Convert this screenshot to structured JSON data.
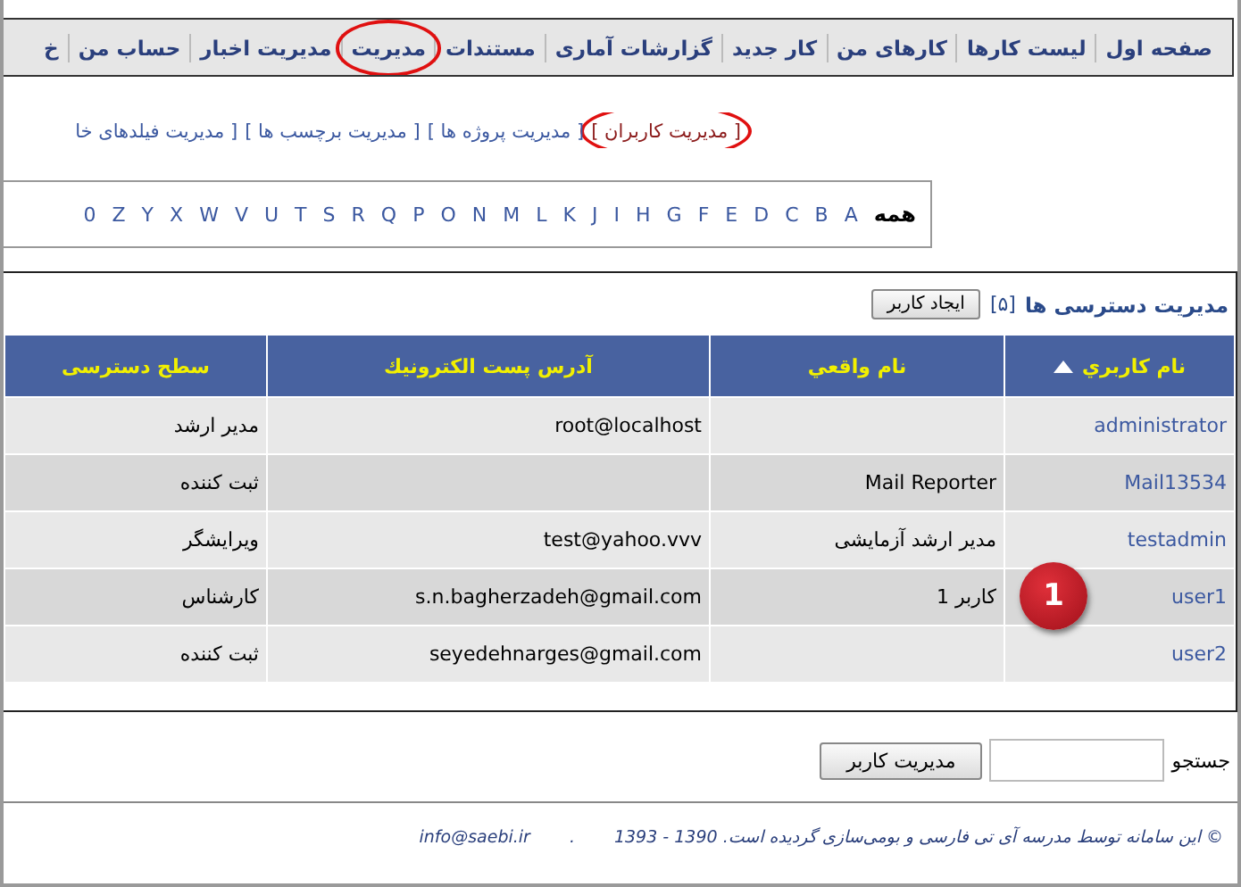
{
  "nav": [
    {
      "label": "صفحه اول",
      "circled": false
    },
    {
      "label": "لیست کارها",
      "circled": false
    },
    {
      "label": "کارهای من",
      "circled": false
    },
    {
      "label": "کار جدید",
      "circled": false
    },
    {
      "label": "گزارشات آماری",
      "circled": false
    },
    {
      "label": "مستندات",
      "circled": false
    },
    {
      "label": "مدیریت",
      "circled": true
    },
    {
      "label": "مدیریت اخبار",
      "circled": false
    },
    {
      "label": "حساب من",
      "circled": false
    },
    {
      "label": "خ",
      "circled": false
    }
  ],
  "sublinks": [
    {
      "label": "[ مدیریت کاربران ]",
      "selected": true,
      "circled": true
    },
    {
      "label": "[ مدیریت پروژه ها ]",
      "selected": false,
      "circled": false
    },
    {
      "label": "[ مدیریت برچسب ها ]",
      "selected": false,
      "circled": false
    },
    {
      "label": "[ مدیریت فیلدهای خا",
      "selected": false,
      "circled": false
    }
  ],
  "letters": [
    {
      "label": "همه",
      "selected": true
    },
    {
      "label": "A",
      "selected": false
    },
    {
      "label": "B",
      "selected": false
    },
    {
      "label": "C",
      "selected": false
    },
    {
      "label": "D",
      "selected": false
    },
    {
      "label": "E",
      "selected": false
    },
    {
      "label": "F",
      "selected": false
    },
    {
      "label": "G",
      "selected": false
    },
    {
      "label": "H",
      "selected": false
    },
    {
      "label": "I",
      "selected": false
    },
    {
      "label": "J",
      "selected": false
    },
    {
      "label": "K",
      "selected": false
    },
    {
      "label": "L",
      "selected": false
    },
    {
      "label": "M",
      "selected": false
    },
    {
      "label": "N",
      "selected": false
    },
    {
      "label": "O",
      "selected": false
    },
    {
      "label": "P",
      "selected": false
    },
    {
      "label": "Q",
      "selected": false
    },
    {
      "label": "R",
      "selected": false
    },
    {
      "label": "S",
      "selected": false
    },
    {
      "label": "T",
      "selected": false
    },
    {
      "label": "U",
      "selected": false
    },
    {
      "label": "V",
      "selected": false
    },
    {
      "label": "W",
      "selected": false
    },
    {
      "label": "X",
      "selected": false
    },
    {
      "label": "Y",
      "selected": false
    },
    {
      "label": "Z",
      "selected": false
    },
    {
      "label": "0",
      "selected": false
    }
  ],
  "panel": {
    "title": "مدیریت دسترسی ها",
    "count": "[۵]",
    "create_button": "ایجاد کاربر"
  },
  "table": {
    "columns": [
      {
        "label": "نام کاربري",
        "sorted": true
      },
      {
        "label": "نام واقعي",
        "sorted": false
      },
      {
        "label": "آدرس پست الكترونيك",
        "sorted": false
      },
      {
        "label": "سطح دسترسی",
        "sorted": false
      }
    ],
    "rows": [
      {
        "cells": [
          "administrator",
          "",
          "root@localhost",
          "مدیر ارشد"
        ],
        "badge": ""
      },
      {
        "cells": [
          "Mail13534",
          "Mail Reporter",
          "",
          "ثبت کننده"
        ],
        "badge": ""
      },
      {
        "cells": [
          "testadmin",
          "مدیر ارشد آزمایشی",
          "test@yahoo.vvv",
          "ویرایشگر"
        ],
        "badge": ""
      },
      {
        "cells": [
          "user1",
          "کاربر 1",
          "s.n.bagherzadeh@gmail.com",
          "کارشناس"
        ],
        "badge": "1"
      },
      {
        "cells": [
          "user2",
          "",
          "seyedehnarges@gmail.com",
          "ثبت کننده"
        ],
        "badge": ""
      }
    ]
  },
  "search": {
    "label": "جستجو",
    "button": "مدیریت کاربر"
  },
  "footer": {
    "text": "© این سامانه توسط مدرسه آی تی فارسی و بومی‌سازی گردیده است. 1390 - 1393",
    "separator": ".",
    "email": "info@saebi.ir"
  }
}
